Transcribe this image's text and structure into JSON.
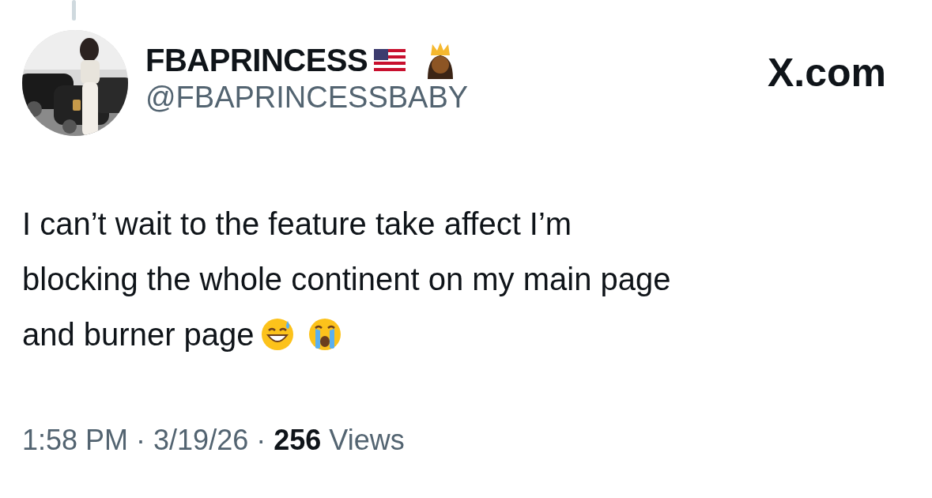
{
  "author": {
    "name": "FBAPRINCESS",
    "handle": "@FBAPRINCESSBABY"
  },
  "site_label": "X.com",
  "tweet": {
    "lines": [
      "I can’t wait to the feature take affect I’m",
      "blocking the whole continent on my main page",
      "and burner page"
    ]
  },
  "footer": {
    "time": "1:58 PM",
    "separator_1": "·",
    "date": "3/19/26",
    "separator_2": "·",
    "views_count": "256",
    "views_label": "Views"
  }
}
